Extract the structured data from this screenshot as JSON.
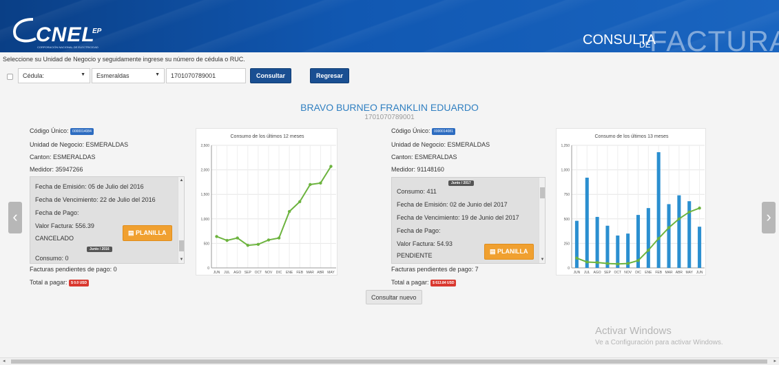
{
  "header": {
    "logo_text": "CNEL",
    "logo_ep": "EP",
    "logo_sub": "CORPORACIÓN NACIONAL DE ELECTRICIDAD",
    "title_consulta": "CONSULTA",
    "title_de": "DE",
    "title_facturas": "FACTURAS"
  },
  "form": {
    "instruction": "Seleccione su Unidad de Negocio y seguidamente ingrese su número de cédula o RUC.",
    "doc_type": "Cédula:",
    "business_unit": "Esmeraldas",
    "id_value": "1701070789001",
    "consult_label": "Consultar",
    "back_label": "Regresar"
  },
  "customer": {
    "name": "BRAVO BURNEO FRANKLIN EDUARDO",
    "id": "1701070789001"
  },
  "accounts": [
    {
      "codigo_label": "Código Único:",
      "codigo_value": "0000014084",
      "unidad": "Unidad de Negocio: ESMERALDAS",
      "canton": "Canton: ESMERALDAS",
      "medidor": "Medidor: 35947266",
      "invoice": {
        "emision": "Fecha de Emisión: 05 de Julio del 2016",
        "vencimiento": "Fecha de Vencimiento: 22 de Julio del 2016",
        "pago": "Fecha de Pago:",
        "valor": "Valor Factura: 556.39",
        "status": "CANCELADO",
        "date_tag": "Junio / 2016",
        "consumo": "Consumo: 0",
        "planilla_label": "PLANILLA"
      },
      "pendientes": "Facturas pendientes de pago: 0",
      "total_label": "Total a pagar:",
      "total_value": "$ 0.0 USD"
    },
    {
      "codigo_label": "Código Único:",
      "codigo_value": "0000014081",
      "unidad": "Unidad de Negocio: ESMERALDAS",
      "canton": "Canton: ESMERALDAS",
      "medidor": "Medidor: 91148160",
      "invoice": {
        "date_tag": "Junio / 2017",
        "consumo": "Consumo: 411",
        "emision": "Fecha de Emisión: 02 de Junio del 2017",
        "vencimiento": "Fecha de Vencimiento: 19 de Junio del 2017",
        "pago": "Fecha de Pago:",
        "valor": "Valor Factura: 54.93",
        "status": "PENDIENTE",
        "planilla_label": "PLANILLA"
      },
      "pendientes": "Facturas pendientes de pago: 7",
      "total_label": "Total a pagar:",
      "total_value": "$ 613.84 USD"
    }
  ],
  "consult_new_label": "Consultar nuevo",
  "watermark": {
    "line1": "Activar Windows",
    "line2": "Ve a Configuración para activar Windows."
  },
  "colors": {
    "header_blue": "#1158b2",
    "line_green": "#6cb33e",
    "bar_blue": "#2b8fd0",
    "planilla_orange": "#f0a030",
    "badge_red": "#d9382f"
  },
  "chart_data": [
    {
      "type": "line",
      "title": "Consumo de los últimos 12 meses",
      "categories": [
        "JUN",
        "JUL",
        "AGO",
        "SEP",
        "OCT",
        "NOV",
        "DIC",
        "ENE",
        "FEB",
        "MAR",
        "ABR",
        "MAY"
      ],
      "series": [
        {
          "values": [
            640,
            560,
            610,
            460,
            480,
            570,
            610,
            1150,
            1350,
            1700,
            1730,
            2070
          ]
        }
      ],
      "yticks": [
        "0",
        "500",
        "1,000",
        "1,500",
        "2,000",
        "2,500"
      ],
      "ylim": [
        0,
        2500
      ],
      "grid": true
    },
    {
      "type": "bar",
      "title": "Consumo de los últimos 13 meses",
      "categories": [
        "JUN",
        "JUL",
        "AGO",
        "SEP",
        "OCT",
        "NOV",
        "DIC",
        "ENE",
        "FEB",
        "MAR",
        "ABR",
        "MAY",
        "JUN"
      ],
      "series": [
        {
          "type": "bar",
          "values": [
            480,
            920,
            520,
            430,
            330,
            350,
            540,
            610,
            1180,
            650,
            740,
            680,
            420
          ]
        },
        {
          "type": "line",
          "values": [
            100,
            60,
            55,
            45,
            40,
            45,
            75,
            180,
            300,
            410,
            500,
            570,
            610
          ]
        }
      ],
      "yticks": [
        "0",
        "250",
        "500",
        "750",
        "1,000",
        "1,250"
      ],
      "ylim": [
        0,
        1250
      ],
      "grid": true
    }
  ]
}
